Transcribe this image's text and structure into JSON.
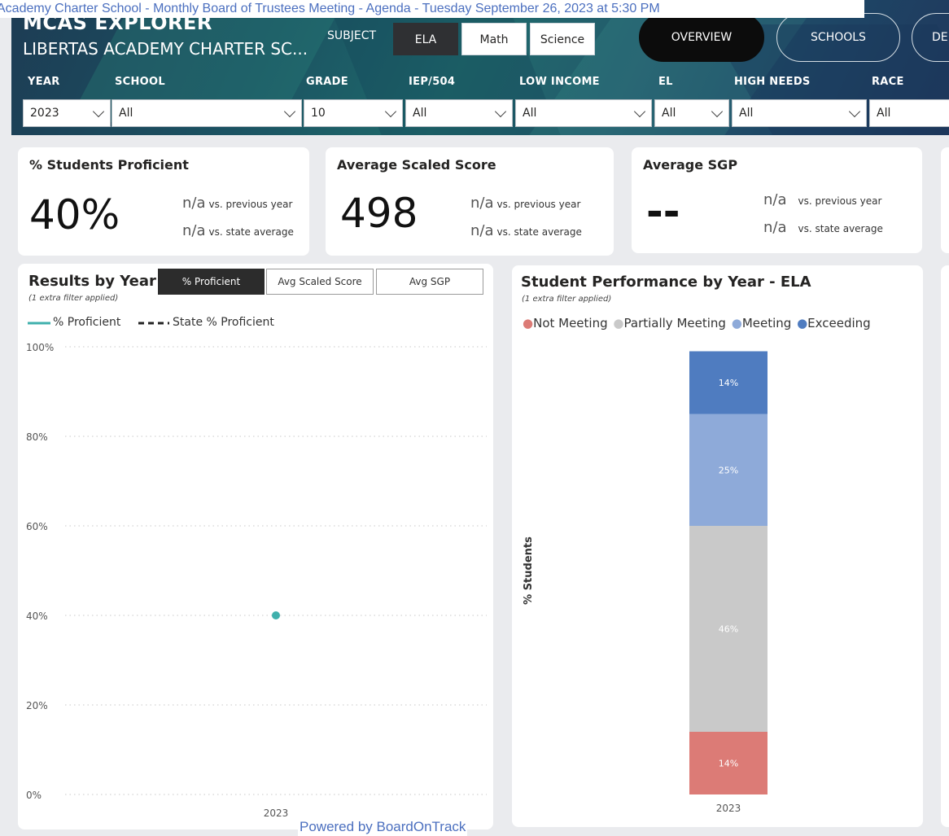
{
  "banner": "Academy Charter School - Monthly Board of Trustees Meeting - Agenda - Tuesday September 26, 2023 at 5:30 PM",
  "header": {
    "app_title": "MCAS EXPLORER",
    "school_name": "LIBERTAS ACADEMY CHARTER SC...",
    "subject_label": "SUBJECT",
    "subjects": [
      "ELA",
      "Math",
      "Science"
    ],
    "selected_subject": "ELA",
    "nav": [
      "OVERVIEW",
      "SCHOOLS",
      "DEM"
    ],
    "selected_nav": "OVERVIEW"
  },
  "filters": [
    {
      "label": "YEAR",
      "value": "2023"
    },
    {
      "label": "SCHOOL",
      "value": "All"
    },
    {
      "label": "GRADE",
      "value": "10"
    },
    {
      "label": "IEP/504",
      "value": "All"
    },
    {
      "label": "LOW INCOME",
      "value": "All"
    },
    {
      "label": "EL",
      "value": "All"
    },
    {
      "label": "HIGH NEEDS",
      "value": "All"
    },
    {
      "label": "RACE",
      "value": "All"
    }
  ],
  "kpis": [
    {
      "title": "% Students Proficient",
      "value": "40%",
      "prev_value": "n/a",
      "prev_label": "vs. previous year",
      "state_value": "n/a",
      "state_label": "vs. state average"
    },
    {
      "title": "Average Scaled Score",
      "value": "498",
      "prev_value": "n/a",
      "prev_label": "vs. previous year",
      "state_value": "n/a",
      "state_label": "vs. state average"
    },
    {
      "title": "Average SGP",
      "value": "--",
      "prev_value": "n/a",
      "prev_label": "vs. previous year",
      "state_value": "n/a",
      "state_label": "vs. state average"
    }
  ],
  "results_panel": {
    "title": "Results by Year",
    "subtitle": "(1 extra filter applied)",
    "toggles": [
      "% Proficient",
      "Avg Scaled Score",
      "Avg SGP"
    ],
    "active_toggle": "% Proficient",
    "legend": [
      "% Proficient",
      "State % Proficient"
    ]
  },
  "performance_panel": {
    "title": "Student Performance by Year - ELA",
    "subtitle": "(1 extra filter applied)",
    "legend": [
      {
        "name": "Not Meeting",
        "color": "#dc7b76"
      },
      {
        "name": "Partially Meeting",
        "color": "#c9c9c9"
      },
      {
        "name": "Meeting",
        "color": "#8eaad9"
      },
      {
        "name": "Exceeding",
        "color": "#4f7cc0"
      }
    ]
  },
  "footer": "Powered by BoardOnTrack",
  "chart_data": [
    {
      "type": "line",
      "title": "Results by Year",
      "x": [
        "2023"
      ],
      "series": [
        {
          "name": "% Proficient",
          "values": [
            40
          ],
          "color": "#3fb0ac",
          "style": "solid"
        },
        {
          "name": "State % Proficient",
          "values": [
            null
          ],
          "color": "#222222",
          "style": "dashed"
        }
      ],
      "ylim": [
        0,
        100
      ],
      "yticks": [
        "0%",
        "20%",
        "40%",
        "60%",
        "80%",
        "100%"
      ],
      "grid": true,
      "legend": "top-left"
    },
    {
      "type": "bar",
      "stacked": true,
      "title": "Student Performance by Year - ELA",
      "categories": [
        "2023"
      ],
      "ylabel": "% Students",
      "ylim": [
        0,
        100
      ],
      "series": [
        {
          "name": "Not Meeting",
          "values": [
            14
          ],
          "color": "#dc7b76"
        },
        {
          "name": "Partially Meeting",
          "values": [
            46
          ],
          "color": "#c9c9c9"
        },
        {
          "name": "Meeting",
          "values": [
            25
          ],
          "color": "#8eaad9"
        },
        {
          "name": "Exceeding",
          "values": [
            14
          ],
          "color": "#4f7cc0"
        }
      ],
      "data_labels": [
        "14%",
        "46%",
        "25%",
        "14%"
      ],
      "legend": "top-left"
    }
  ]
}
